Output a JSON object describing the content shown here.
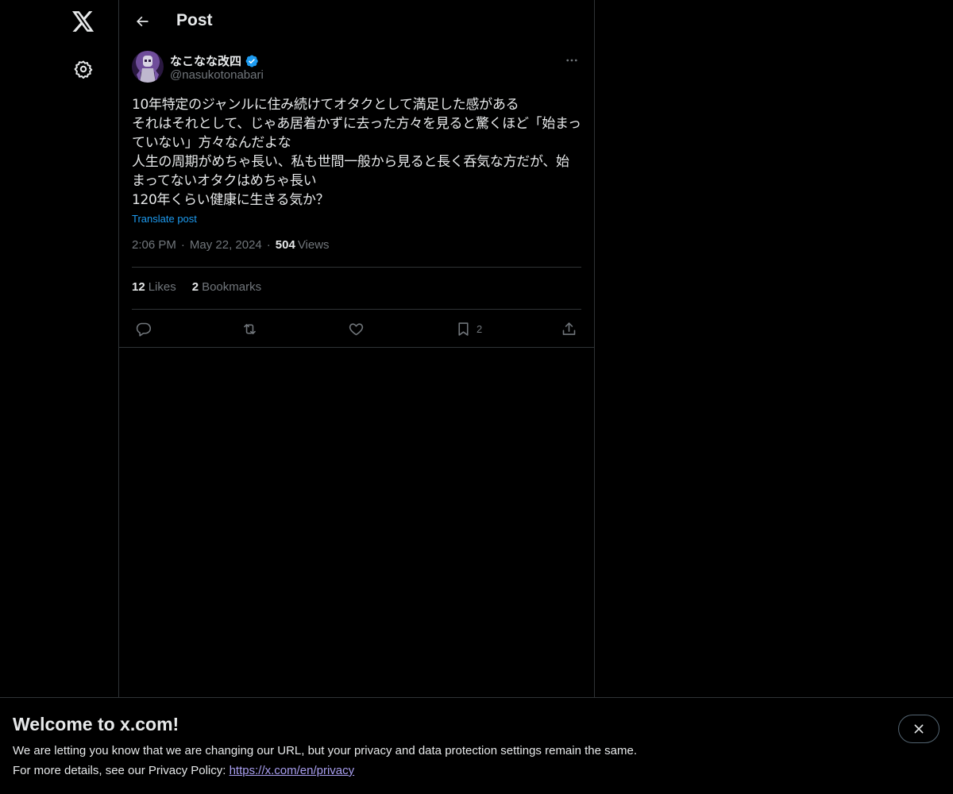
{
  "header": {
    "title": "Post"
  },
  "post": {
    "author_name": "なこなな改四",
    "author_handle": "@nasukotonabari",
    "text": "10年特定のジャンルに住み続けてオタクとして満足した感がある\nそれはそれとして、じゃあ居着かずに去った方々を見ると驚くほど「始まっていない」方々なんだよな\n人生の周期がめちゃ長い、私も世間一般から見ると長く呑気な方だが、始まってないオタクはめちゃ長い\n120年くらい健康に生きる気か？",
    "translate_label": "Translate post",
    "time": "2:06 PM",
    "date": "May 22, 2024",
    "views_count": "504",
    "views_label": "Views",
    "likes_count": "12",
    "likes_label": "Likes",
    "bookmarks_count": "2",
    "bookmarks_label": "Bookmarks",
    "bookmark_action_count": "2"
  },
  "banner": {
    "title": "Welcome to x.com!",
    "line1": "We are letting you know that we are changing our URL, but your privacy and data protection settings remain the same.",
    "line2_prefix": "For more details, see our Privacy Policy: ",
    "link": "https://x.com/en/privacy"
  },
  "icons": {
    "logo": "x-logo-icon",
    "settings": "gear-icon",
    "back": "arrow-left-icon",
    "verified": "verified-badge-icon",
    "more": "more-horizontal-icon",
    "reply": "reply-icon",
    "retweet": "retweet-icon",
    "like": "heart-icon",
    "bookmark": "bookmark-icon",
    "share": "share-icon",
    "close": "close-icon"
  },
  "colors": {
    "background": "#000000",
    "text": "#e7e9ea",
    "muted": "#71767b",
    "accent": "#1d9bf0",
    "border": "#2f3336"
  }
}
